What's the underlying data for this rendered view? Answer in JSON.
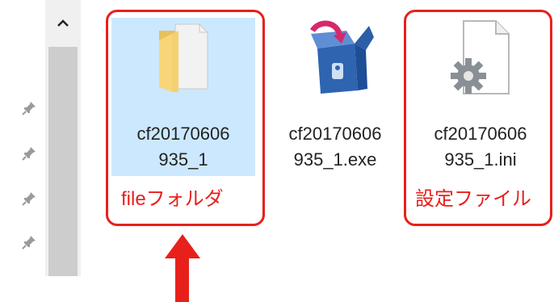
{
  "files": [
    {
      "name": "cf20170606\n935_1",
      "type": "folder",
      "icon": "folder-icon"
    },
    {
      "name": "cf20170606\n935_1.exe",
      "type": "exe",
      "icon": "installer-exe-icon"
    },
    {
      "name": "cf20170606\n935_1.ini",
      "type": "ini",
      "icon": "settings-file-icon"
    }
  ],
  "annotations": {
    "folder_label": "fileフォルダ",
    "settings_label": "設定ファイル"
  },
  "colors": {
    "annotation_red": "#e8201c",
    "selection_blue": "#cce8ff"
  }
}
